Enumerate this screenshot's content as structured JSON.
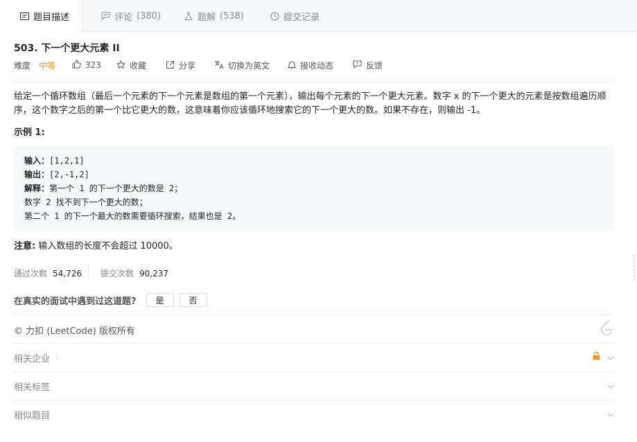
{
  "tabs": [
    {
      "label": "题目描述",
      "count": "",
      "icon": "description-icon",
      "active": true
    },
    {
      "label": "评论",
      "count": "(380)",
      "icon": "comment-icon",
      "active": false
    },
    {
      "label": "题解",
      "count": "(538)",
      "icon": "solution-flask-icon",
      "active": false
    },
    {
      "label": "提交记录",
      "count": "",
      "icon": "history-clock-icon",
      "active": false
    }
  ],
  "problem": {
    "title": "503. 下一个更大元素 II",
    "difficulty_label": "难度",
    "difficulty": "中等",
    "likes": "323",
    "favorite_label": "收藏",
    "share_label": "分享",
    "translate_label": "切换为英文",
    "follow_label": "接收动态",
    "feedback_label": "反馈",
    "description_line1": "给定一个循环数组（最后一个元素的下一个元素是数组的第一个元素），输出每个元素的下一个更大元素。数字 x 的下一个更大的元素是按数组遍历顺",
    "description_line2": "序，这个数字之后的第一个比它更大的数，这意味着你应该循环地搜索它的下一个更大的数。如果不存在，则输出 -1。",
    "example_title": "示例 1:",
    "example": {
      "input_label": "输入：",
      "input_value": "[1,2,1]",
      "output_label": "输出：",
      "output_value": "[2,-1,2]",
      "explain_label": "解释：",
      "explain_line1": "第一个 1 的下一个更大的数是 2；",
      "explain_line2": "数字 2 找不到下一个更大的数；",
      "explain_line3": "第二个 1 的下一个最大的数需要循环搜索，结果也是 2。"
    },
    "note_label": "注意:",
    "note_text": " 输入数组的长度不会超过 10000。"
  },
  "stats": {
    "accepted_label": "通过次数",
    "accepted_value": "54,726",
    "submitted_label": "提交次数",
    "submitted_value": "90,237"
  },
  "interview": {
    "question": "在真实的面试中遇到过这道题?",
    "yes": "是",
    "no": "否"
  },
  "footer": {
    "copyright": "© 力扣 (LeetCode) 版权所有",
    "related_companies": "相关企业",
    "related_tags": "相关标签",
    "similar_problems": "相似题目"
  },
  "colors": {
    "difficulty_medium": "#ef9a2c",
    "lock": "#ef9a2c",
    "tab_bar_bg": "#f7f8fa",
    "code_bg": "#f7f8fa"
  }
}
